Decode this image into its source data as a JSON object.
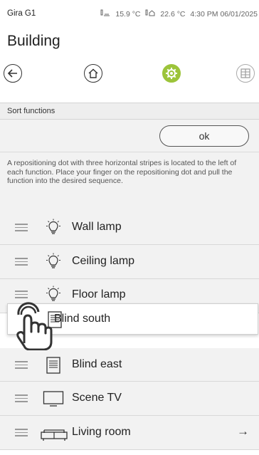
{
  "status_bar": {
    "device": "Gira G1",
    "outdoor_temp": "15.9 °C",
    "indoor_temp": "22.6 °C",
    "time_date": "4:30 PM 06/01/2025"
  },
  "page": {
    "title": "Building"
  },
  "nav": {
    "back_icon": "arrow-left-icon",
    "home_icon": "house-icon",
    "settings_icon": "gear-icon",
    "grid_icon": "grid-icon",
    "active_color": "#9cc43a"
  },
  "sort_panel": {
    "header": "Sort functions",
    "ok_label": "ok",
    "instructions": "A repositioning dot with three horizontal stripes is located to the left of each function. Place your finger on the repositioning dot and pull the function into the desired sequence."
  },
  "functions": [
    {
      "label": "Wall lamp",
      "icon": "lightbulb-icon"
    },
    {
      "label": "Ceiling lamp",
      "icon": "lightbulb-icon"
    },
    {
      "label": "Floor lamp",
      "icon": "lightbulb-icon"
    },
    {
      "label": "Blind east",
      "icon": "blind-icon"
    },
    {
      "label": "Scene TV",
      "icon": "tv-icon"
    },
    {
      "label": "Living room",
      "icon": "sofa-icon",
      "arrow": "→"
    }
  ],
  "dragged_item": {
    "label": "Blind south",
    "icon": "blind-icon"
  }
}
